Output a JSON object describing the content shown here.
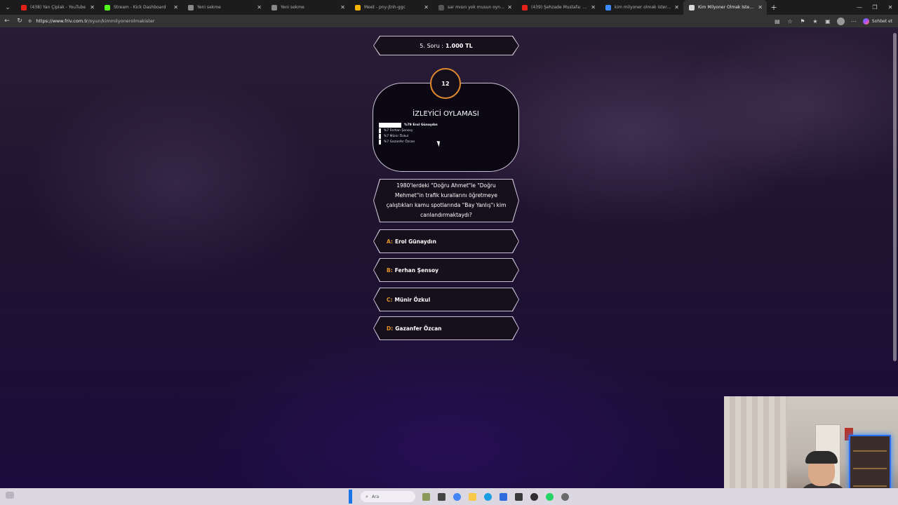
{
  "browser": {
    "tabs": [
      {
        "title": "(438) Yan Çiplak - YouTube",
        "favicon_color": "#e62117",
        "active": false
      },
      {
        "title": "Stream - Kick Dashboard",
        "favicon_color": "#53fc18",
        "active": false
      },
      {
        "title": "Yeni sekme",
        "favicon_color": "#888888",
        "active": false
      },
      {
        "title": "Yeni sekme",
        "favicon_color": "#888888",
        "active": false
      },
      {
        "title": "Meet - pny-jtnh-ggc",
        "favicon_color": "#f4b400",
        "active": false
      },
      {
        "title": "sar mısın yok musun oyna - Arama",
        "favicon_color": "#555555",
        "active": false
      },
      {
        "title": "(439) Şehzade Mustafa: Zahit bizi...",
        "favicon_color": "#e62117",
        "active": false
      },
      {
        "title": "kim milyoner olmak ister oyna - A...",
        "favicon_color": "#3c8cff",
        "active": false
      },
      {
        "title": "Kim Milyoner Olmak İster Oy...",
        "favicon_color": "#d8d8d8",
        "active": true
      }
    ],
    "address": {
      "host": "https://www.friv.com.tr",
      "path": "/oyun/kimmilyonerolmakister"
    },
    "chat_label": "Sohbet et"
  },
  "game": {
    "prize": {
      "question_label": "5. Soru :",
      "amount": "1.000 TL"
    },
    "timer": "12",
    "poll": {
      "title": "İZLEYİCİ OYLAMASI",
      "options": [
        {
          "label": "%79 Erol Günaydın",
          "percent": 79
        },
        {
          "label": "%7 Ferhan Şensoy",
          "percent": 7
        },
        {
          "label": "%7 Münir Özkul",
          "percent": 7
        },
        {
          "label": "%7 Gazanfer Özcan",
          "percent": 7
        }
      ]
    },
    "question": "1980'lerdeki \"Doğru Ahmet\"le \"Doğru Mehmet\"in trafik kurallarını öğretmeye çalıştıkları kamu spotlarında \"Bay Yanlış\"ı kim canlandırmaktaydı?",
    "answers": [
      {
        "key": "A:",
        "text": "Erol Günaydın"
      },
      {
        "key": "B:",
        "text": "Ferhan Şensoy"
      },
      {
        "key": "C:",
        "text": "Münir Özkul"
      },
      {
        "key": "D:",
        "text": "Gazanfer Özcan"
      }
    ]
  },
  "taskbar": {
    "search_placeholder": "Ara"
  }
}
